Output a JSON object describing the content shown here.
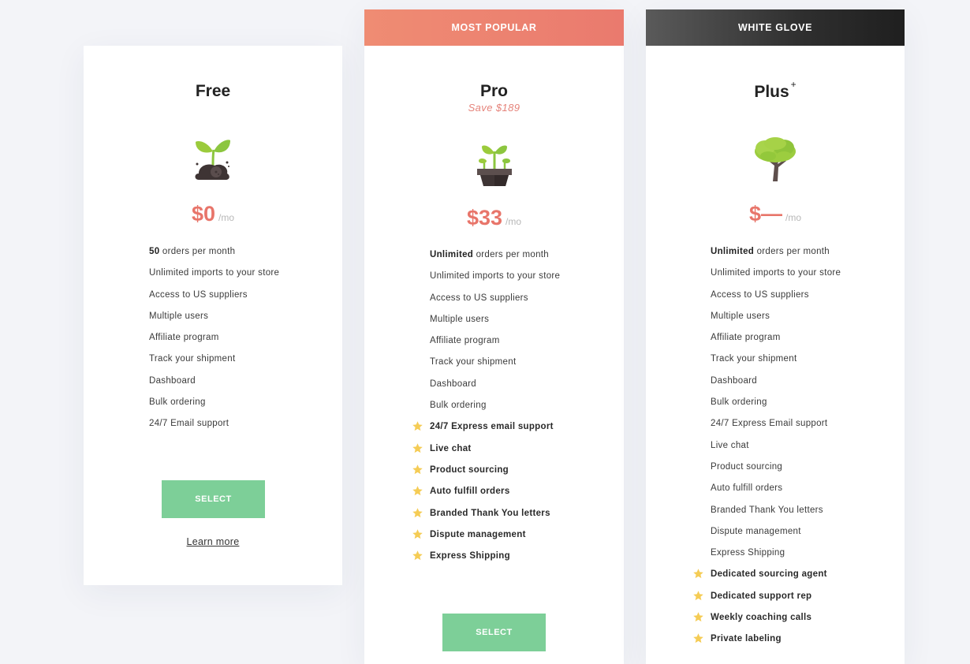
{
  "colors": {
    "page_bg": "#f3f4f8",
    "price_accent": "#e8756a",
    "select_button": "#7dcf98",
    "popular_banner": "#ec8370",
    "white_glove_banner": "#2f2f2f",
    "star": "#f5cc55"
  },
  "plans": [
    {
      "name": "Free",
      "icon": "sprout-in-soil-icon",
      "price": "$0",
      "per": "/mo",
      "features": [
        {
          "strong": "50",
          "text": " orders per month",
          "starred": false,
          "bold": false
        },
        {
          "strong": "",
          "text": "Unlimited imports to your store",
          "starred": false,
          "bold": false
        },
        {
          "strong": "",
          "text": "Access to US suppliers",
          "starred": false,
          "bold": false
        },
        {
          "strong": "",
          "text": "Multiple users",
          "starred": false,
          "bold": false
        },
        {
          "strong": "",
          "text": "Affiliate program",
          "starred": false,
          "bold": false
        },
        {
          "strong": "",
          "text": "Track your shipment",
          "starred": false,
          "bold": false
        },
        {
          "strong": "",
          "text": "Dashboard",
          "starred": false,
          "bold": false
        },
        {
          "strong": "",
          "text": "Bulk ordering",
          "starred": false,
          "bold": false
        },
        {
          "strong": "",
          "text": "24/7 Email support",
          "starred": false,
          "bold": false
        }
      ],
      "select_label": "SELECT",
      "learn_more_label": "Learn more"
    },
    {
      "banner": "MOST POPULAR",
      "name": "Pro",
      "save_note": "Save $189",
      "icon": "potted-seedlings-icon",
      "price": "$33",
      "per": "/mo",
      "features": [
        {
          "strong": "Unlimited",
          "text": " orders per month",
          "starred": false,
          "bold": false
        },
        {
          "strong": "",
          "text": "Unlimited imports to your store",
          "starred": false,
          "bold": false
        },
        {
          "strong": "",
          "text": "Access to US suppliers",
          "starred": false,
          "bold": false
        },
        {
          "strong": "",
          "text": "Multiple users",
          "starred": false,
          "bold": false
        },
        {
          "strong": "",
          "text": "Affiliate program",
          "starred": false,
          "bold": false
        },
        {
          "strong": "",
          "text": "Track your shipment",
          "starred": false,
          "bold": false
        },
        {
          "strong": "",
          "text": "Dashboard",
          "starred": false,
          "bold": false
        },
        {
          "strong": "",
          "text": "Bulk ordering",
          "starred": false,
          "bold": false
        },
        {
          "strong": "",
          "text": "24/7 Express email support",
          "starred": true,
          "bold": true
        },
        {
          "strong": "",
          "text": "Live chat",
          "starred": true,
          "bold": true
        },
        {
          "strong": "",
          "text": "Product sourcing",
          "starred": true,
          "bold": true
        },
        {
          "strong": "",
          "text": "Auto fulfill orders",
          "starred": true,
          "bold": true
        },
        {
          "strong": "",
          "text": "Branded Thank You letters",
          "starred": true,
          "bold": true
        },
        {
          "strong": "",
          "text": "Dispute management",
          "starred": true,
          "bold": true
        },
        {
          "strong": "",
          "text": "Express Shipping",
          "starred": true,
          "bold": true
        }
      ],
      "select_label": "SELECT"
    },
    {
      "banner": "WHITE GLOVE",
      "name": "Plus",
      "name_sup": "+",
      "icon": "tree-icon",
      "price": "$—",
      "per": "/mo",
      "features": [
        {
          "strong": "Unlimited",
          "text": " orders per month",
          "starred": false,
          "bold": false
        },
        {
          "strong": "",
          "text": "Unlimited imports to your store",
          "starred": false,
          "bold": false
        },
        {
          "strong": "",
          "text": "Access to US suppliers",
          "starred": false,
          "bold": false
        },
        {
          "strong": "",
          "text": "Multiple users",
          "starred": false,
          "bold": false
        },
        {
          "strong": "",
          "text": "Affiliate program",
          "starred": false,
          "bold": false
        },
        {
          "strong": "",
          "text": "Track your shipment",
          "starred": false,
          "bold": false
        },
        {
          "strong": "",
          "text": "Dashboard",
          "starred": false,
          "bold": false
        },
        {
          "strong": "",
          "text": "Bulk ordering",
          "starred": false,
          "bold": false
        },
        {
          "strong": "",
          "text": "24/7 Express Email support",
          "starred": false,
          "bold": false
        },
        {
          "strong": "",
          "text": "Live chat",
          "starred": false,
          "bold": false
        },
        {
          "strong": "",
          "text": "Product sourcing",
          "starred": false,
          "bold": false
        },
        {
          "strong": "",
          "text": "Auto fulfill orders",
          "starred": false,
          "bold": false
        },
        {
          "strong": "",
          "text": "Branded Thank You letters",
          "starred": false,
          "bold": false
        },
        {
          "strong": "",
          "text": "Dispute management",
          "starred": false,
          "bold": false
        },
        {
          "strong": "",
          "text": "Express Shipping",
          "starred": false,
          "bold": false
        },
        {
          "strong": "",
          "text": "Dedicated sourcing agent",
          "starred": true,
          "bold": true
        },
        {
          "strong": "",
          "text": "Dedicated support rep",
          "starred": true,
          "bold": true
        },
        {
          "strong": "",
          "text": "Weekly coaching calls",
          "starred": true,
          "bold": true
        },
        {
          "strong": "",
          "text": "Private labeling",
          "starred": true,
          "bold": true
        }
      ]
    }
  ]
}
